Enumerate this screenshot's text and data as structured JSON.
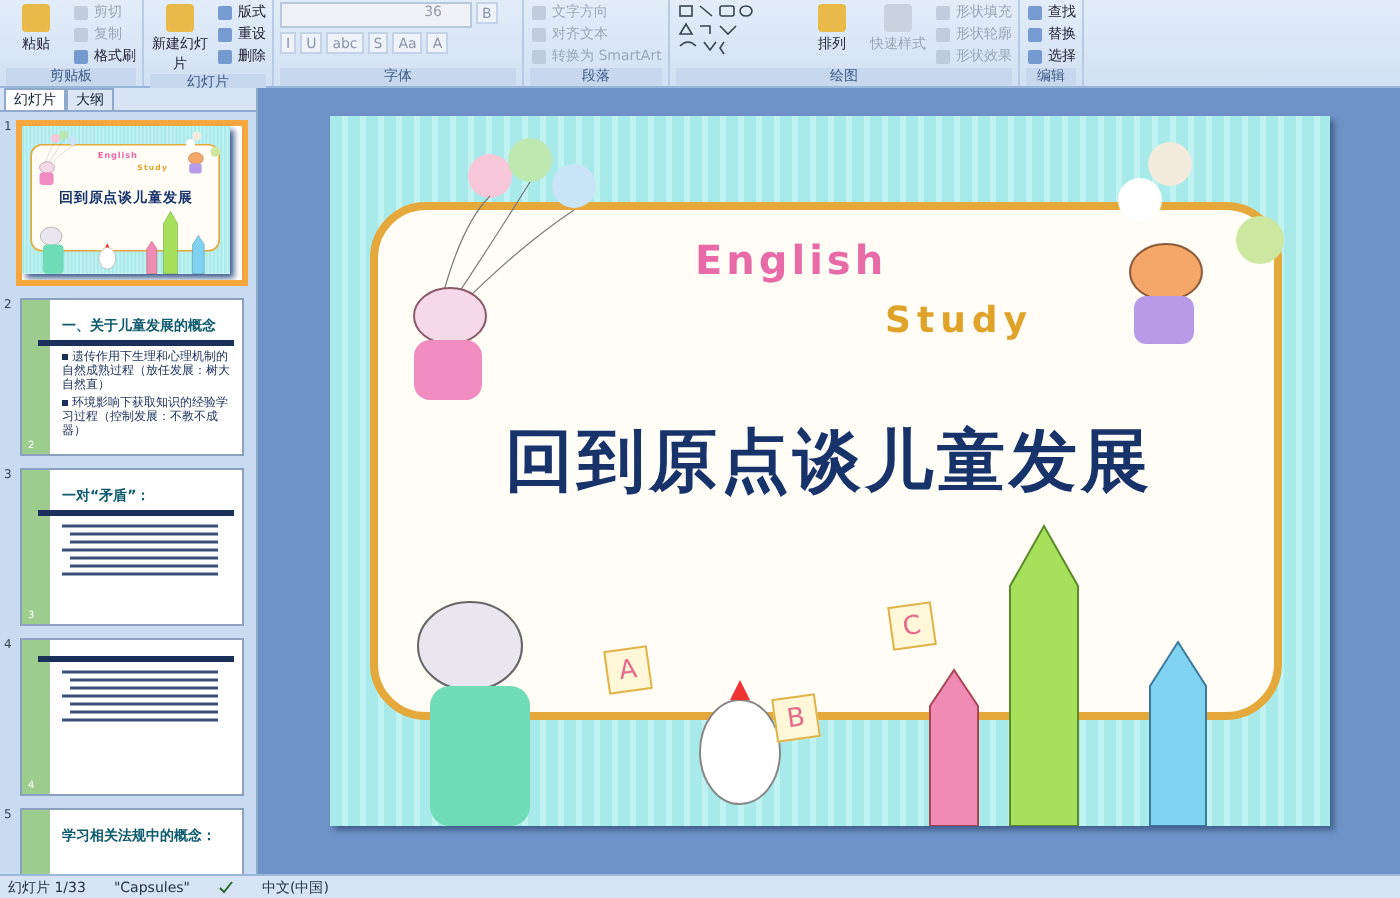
{
  "ribbon": {
    "groups": [
      {
        "label": "剪贴板",
        "items": [
          {
            "kind": "large",
            "label": "粘贴",
            "disabled": false
          },
          {
            "kind": "small",
            "label": "剪切",
            "disabled": true
          },
          {
            "kind": "small",
            "label": "复制",
            "disabled": true
          },
          {
            "kind": "small",
            "label": "格式刷",
            "disabled": false
          }
        ]
      },
      {
        "label": "幻灯片",
        "items": [
          {
            "kind": "large",
            "label": "新建幻灯片",
            "disabled": false
          },
          {
            "kind": "small",
            "label": "版式",
            "disabled": false
          },
          {
            "kind": "small",
            "label": "重设",
            "disabled": false
          },
          {
            "kind": "small",
            "label": "删除",
            "disabled": false
          }
        ]
      },
      {
        "label": "字体",
        "items": [
          {
            "kind": "field",
            "label": "36",
            "disabled": true
          },
          {
            "kind": "glyph",
            "label": "B",
            "disabled": true
          },
          {
            "kind": "glyph",
            "label": "I",
            "disabled": true
          },
          {
            "kind": "glyph",
            "label": "U",
            "disabled": true
          },
          {
            "kind": "glyph",
            "label": "abc",
            "disabled": true
          },
          {
            "kind": "glyph",
            "label": "S",
            "disabled": true
          },
          {
            "kind": "glyph",
            "label": "Aa",
            "disabled": true
          },
          {
            "kind": "glyph",
            "label": "A",
            "disabled": true
          }
        ]
      },
      {
        "label": "段落",
        "items": [
          {
            "kind": "small",
            "label": "文字方向",
            "disabled": true
          },
          {
            "kind": "small",
            "label": "对齐文本",
            "disabled": true
          },
          {
            "kind": "small",
            "label": "转换为 SmartArt",
            "disabled": true
          }
        ]
      },
      {
        "label": "绘图",
        "items": [
          {
            "kind": "gallery",
            "disabled": false
          },
          {
            "kind": "large",
            "label": "排列",
            "disabled": false
          },
          {
            "kind": "large",
            "label": "快速样式",
            "disabled": true
          },
          {
            "kind": "small",
            "label": "形状填充",
            "disabled": true
          },
          {
            "kind": "small",
            "label": "形状轮廓",
            "disabled": true
          },
          {
            "kind": "small",
            "label": "形状效果",
            "disabled": true
          }
        ]
      },
      {
        "label": "编辑",
        "items": [
          {
            "kind": "small",
            "label": "查找",
            "disabled": false
          },
          {
            "kind": "small",
            "label": "替换",
            "disabled": false
          },
          {
            "kind": "small",
            "label": "选择",
            "disabled": false
          }
        ]
      }
    ]
  },
  "panel": {
    "tabs": [
      {
        "label": "幻灯片",
        "selected": true
      },
      {
        "label": "大纲",
        "selected": false
      }
    ],
    "slides": [
      {
        "number": "1",
        "kind": "title",
        "selected": true,
        "title": "回到原点谈儿童发展",
        "english": "English",
        "study": "Study"
      },
      {
        "number": "2",
        "kind": "content",
        "selected": false,
        "title": "一、关于儿童发展的概念",
        "bullets": [
          "遗传作用下生理和心理机制的自然成熟过程（放任发展：树大自然直）",
          "环境影响下获取知识的经验学习过程（控制发展：不教不成器）"
        ],
        "corner": "2"
      },
      {
        "number": "3",
        "kind": "content",
        "selected": false,
        "title": "一对“矛盾”：",
        "corner": "3"
      },
      {
        "number": "4",
        "kind": "content",
        "selected": false,
        "corner": "4"
      },
      {
        "number": "5",
        "kind": "content",
        "selected": false,
        "title": "学习相关法规中的概念："
      }
    ]
  },
  "slide": {
    "english": "English",
    "study": "Study",
    "title": "回到原点谈儿童发展",
    "blocks": [
      "A",
      "B",
      "C"
    ]
  },
  "status_bar": {
    "slide": "幻灯片 1/33",
    "theme": "\"Capsules\"",
    "language": "中文(中国)"
  }
}
